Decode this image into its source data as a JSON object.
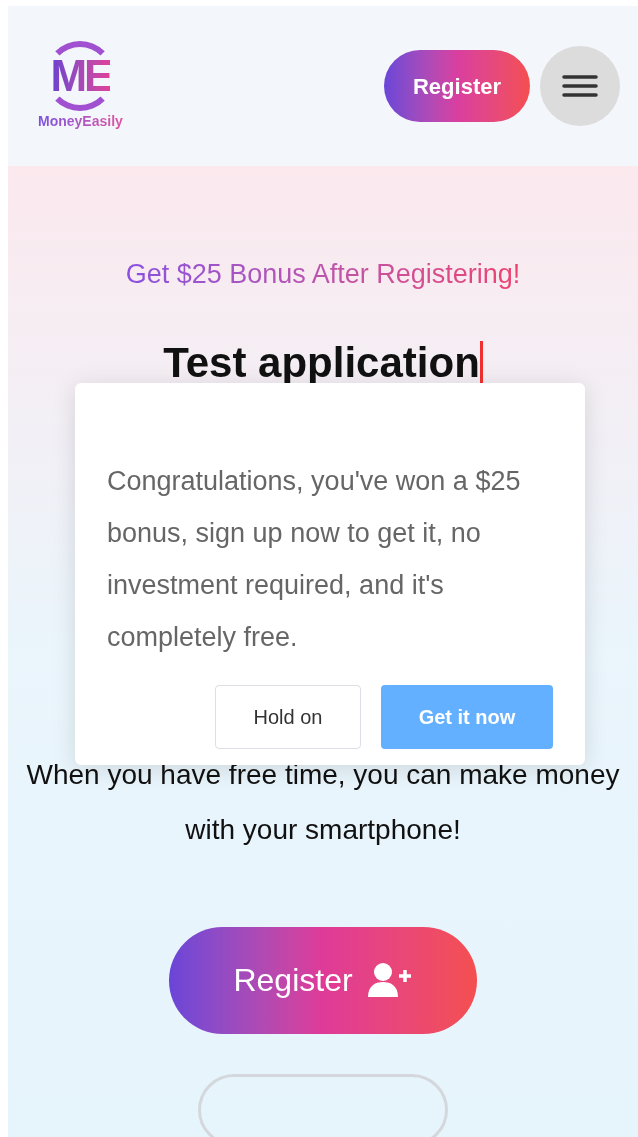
{
  "header": {
    "logo_mark": "ME",
    "logo_text": "MoneyEasily",
    "register_button": "Register"
  },
  "hero": {
    "bonus_text": "Get $25 Bonus After Registering!",
    "title": "Test application",
    "tagline": "When you have free time, you can make money with your smartphone!",
    "register_button": "Register"
  },
  "dialog": {
    "message": "Congratulations, you've won a $25 bonus, sign up now to get it, no investment required, and it's completely free.",
    "buttons": [
      {
        "label": "Hold on",
        "kind": "secondary"
      },
      {
        "label": "Get it now",
        "kind": "primary"
      }
    ]
  }
}
